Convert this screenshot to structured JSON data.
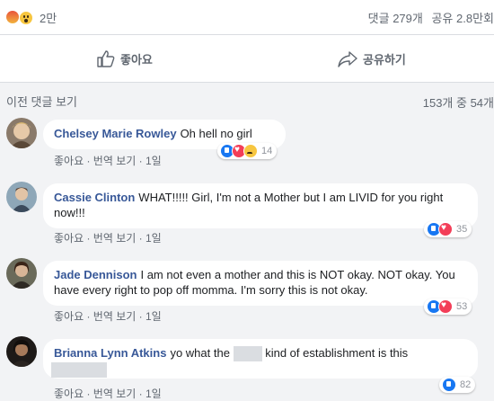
{
  "post_stats": {
    "reaction_count": "2만",
    "comments": "댓글 279개",
    "shares": "공유 2.8만회"
  },
  "actions": {
    "like": "좋아요",
    "share": "공유하기"
  },
  "comments_header": {
    "previous": "이전 댓글 보기",
    "page": "153개 중 54개"
  },
  "comments": [
    {
      "name": "Chelsey Marie Rowley",
      "text": "Oh hell no girl",
      "meta": {
        "like": "좋아요",
        "translate": "번역 보기",
        "time": "1일"
      },
      "reactions": [
        "like",
        "love",
        "sad"
      ],
      "reaction_count": "14"
    },
    {
      "name": "Cassie Clinton",
      "text": "WHAT!!!!! Girl, I'm not a Mother but I am LIVID for you right now!!!",
      "meta": {
        "like": "좋아요",
        "translate": "번역 보기",
        "time": "1일"
      },
      "reactions": [
        "like",
        "love"
      ],
      "reaction_count": "35"
    },
    {
      "name": "Jade Dennison",
      "text": "I am not even a mother and this is NOT okay. NOT okay. You have every right to pop off momma. I'm sorry this is not okay.",
      "meta": {
        "like": "좋아요",
        "translate": "번역 보기",
        "time": "1일"
      },
      "reactions": [
        "like",
        "love"
      ],
      "reaction_count": "53"
    },
    {
      "name": "Brianna Lynn Atkins",
      "text_before": "yo what the",
      "text_after": "kind of establishment is this",
      "meta": {
        "like": "좋아요",
        "translate": "번역 보기",
        "time": "1일"
      },
      "reactions": [
        "like"
      ],
      "reaction_count": "82"
    }
  ],
  "colors": {
    "name_link": "#385898",
    "like_blue": "#1877f2",
    "love_red": "#f33e58",
    "meta_gray": "#606770"
  }
}
